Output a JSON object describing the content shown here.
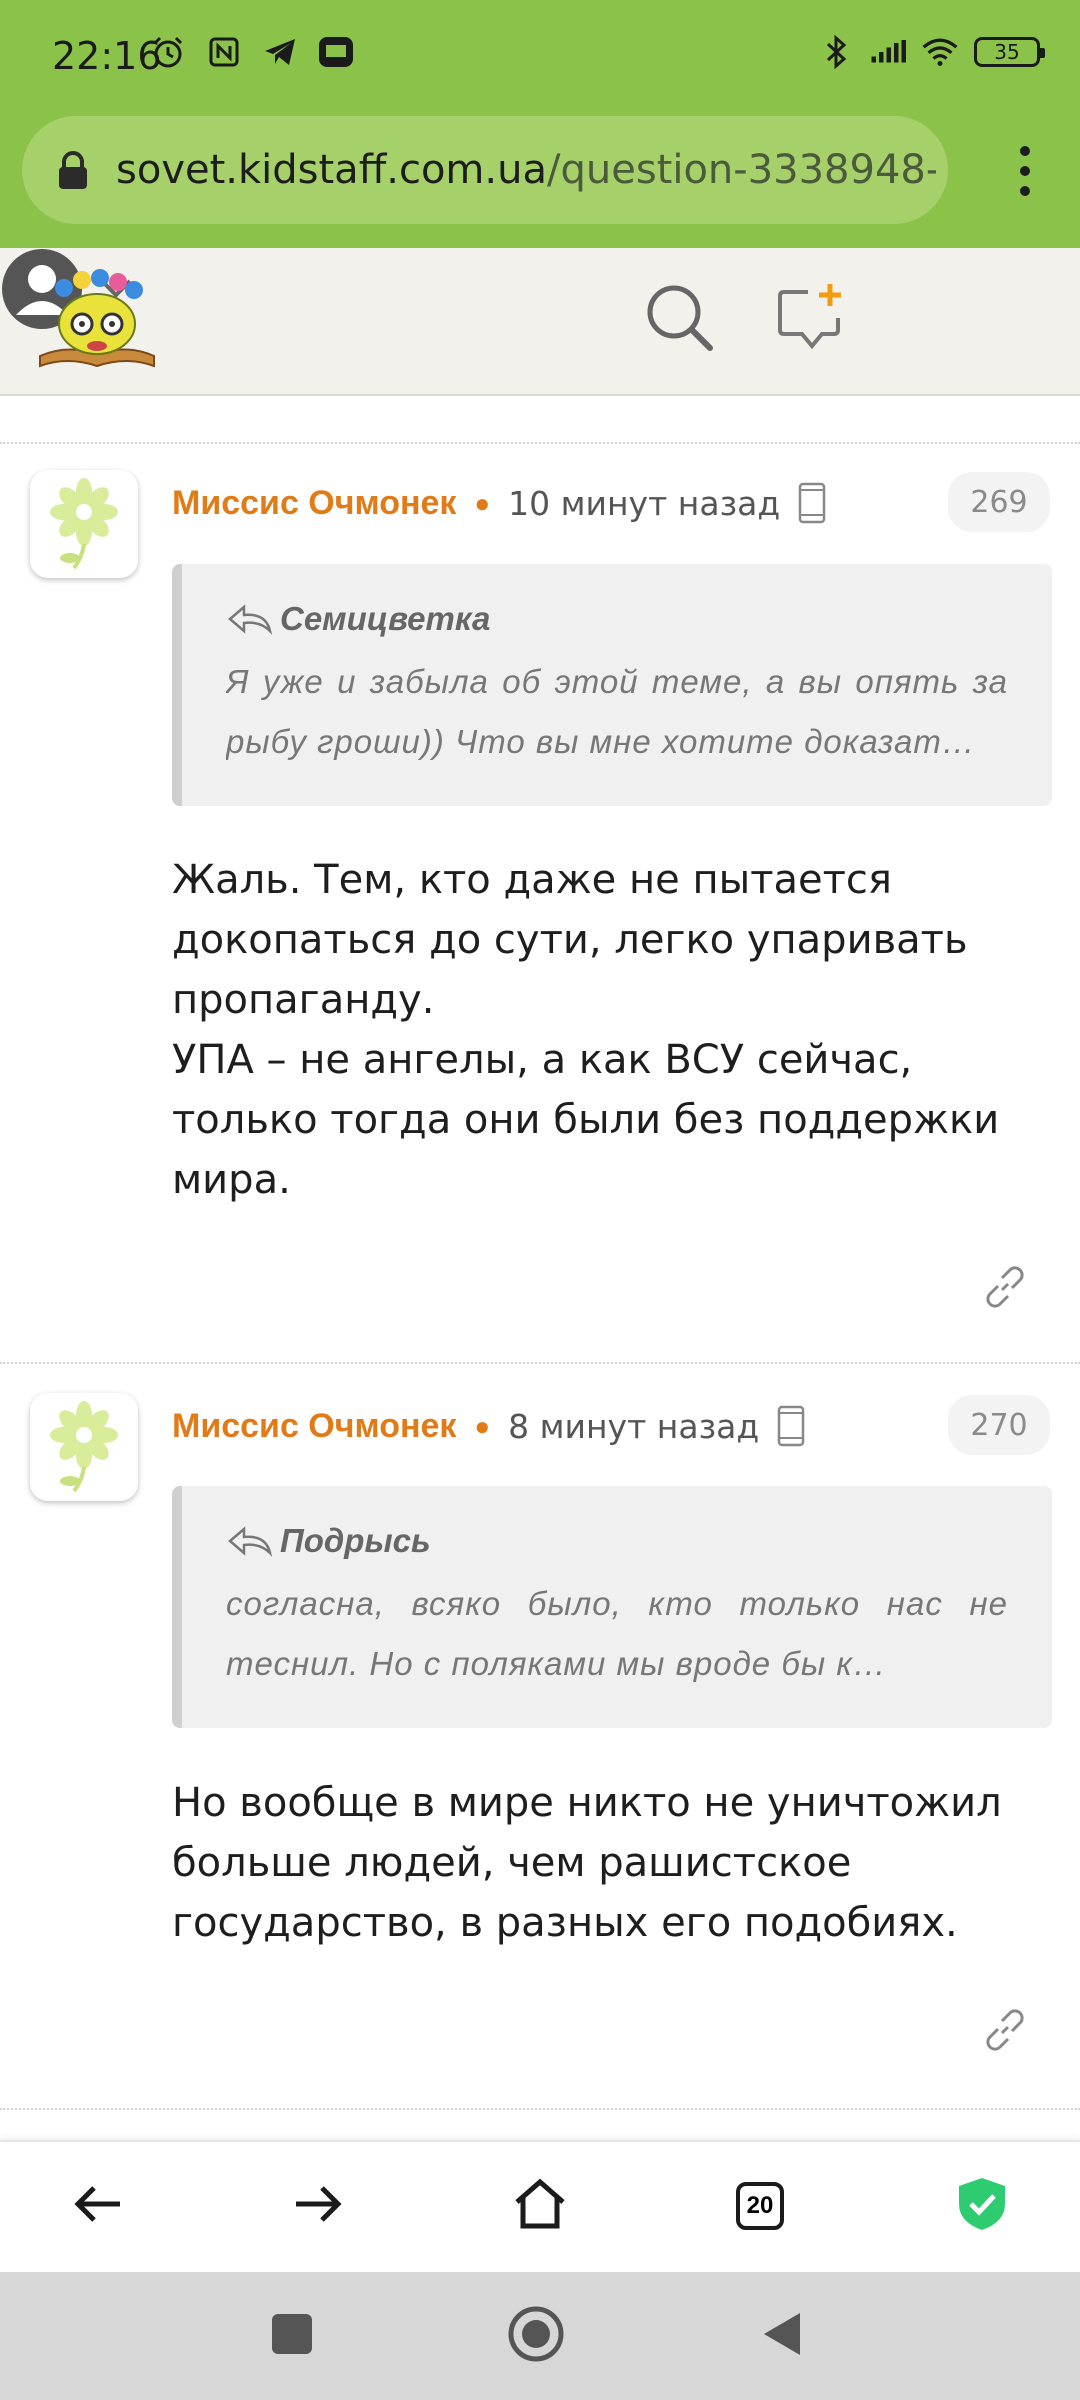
{
  "status_bar": {
    "time": "22:16",
    "battery": "35",
    "left_icons": [
      "alarm-icon",
      "nfc-icon",
      "telegram-icon",
      "adblock-icon"
    ],
    "right_icons": [
      "bluetooth-icon",
      "signal-icon",
      "wifi-icon",
      "battery-icon"
    ]
  },
  "browser": {
    "url_domain": "sovet.kidstaff.com.ua",
    "url_path": "/question-3338948-",
    "tab_count": "20"
  },
  "comments": [
    {
      "author": "Миссис Очмонек",
      "time": "10 минут назад",
      "number": "269",
      "quote_author": "Семицветка",
      "quote_text": "Я уже и забыла об этой теме, а вы опять за рыбу гроши)) Что вы мне хотите доказат…",
      "body": "Жаль. Тем, кто даже не пытается\nдокопаться до сути, легко упаривать\nпропаганду.\nУПА – не ангелы, а как ВСУ сейчас,\nтолько тогда они были без поддержки\nмира."
    },
    {
      "author": "Миссис Очмонек",
      "time": "8 минут назад",
      "number": "270",
      "quote_author": "Подрысь",
      "quote_text": "согласна, всяко было, кто только нас не теснил. Но с поляками мы вроде бы к…",
      "body": "Но вообще в мире никто не уничтожил\nбольше людей, чем рашистское\nгосударство, в разных его подобиях."
    }
  ],
  "colors": {
    "accent_green": "#8bc34a",
    "author_orange": "#e07b18",
    "shield_green": "#2ecc71"
  }
}
